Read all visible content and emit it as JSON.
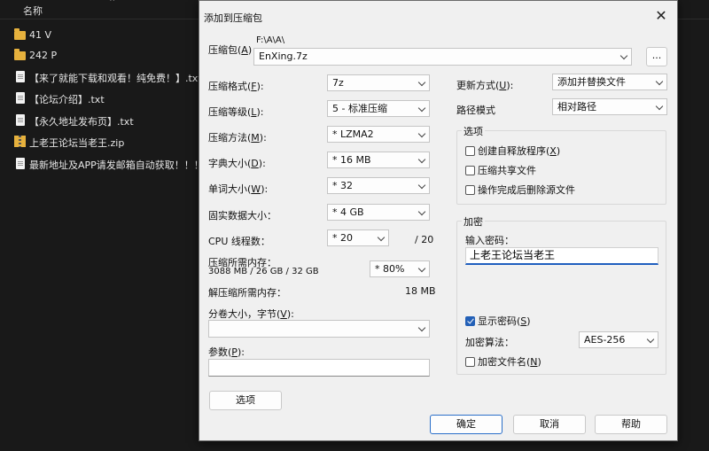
{
  "explorer": {
    "column_name": "名称",
    "items": [
      {
        "name": "41 V",
        "type": "folder"
      },
      {
        "name": "242 P",
        "type": "folder"
      },
      {
        "name": "【来了就能下载和观看！纯免费！】.txt",
        "type": "txt"
      },
      {
        "name": "【论坛介绍】.txt",
        "type": "txt"
      },
      {
        "name": "【永久地址发布页】.txt",
        "type": "txt"
      },
      {
        "name": "上老王论坛当老王.zip",
        "type": "zip"
      },
      {
        "name": "最新地址及APP请发邮箱自动获取！！！.txt",
        "type": "txt"
      }
    ]
  },
  "dialog": {
    "title": "添加到压缩包",
    "close_glyph": "✕",
    "archive": {
      "label": "压缩包(",
      "label_key": "A",
      "label_end": ")",
      "path": "F:\\A\\A\\",
      "filename": "EnXing.7z",
      "browse_label": "..."
    },
    "format": {
      "label": "压缩格式(",
      "key": "F",
      "end": "):",
      "value": "7z"
    },
    "level": {
      "label": "压缩等级(",
      "key": "L",
      "end": "):",
      "value": "5 - 标准压缩"
    },
    "method": {
      "label": "压缩方法(",
      "key": "M",
      "end": "):",
      "value": "* LZMA2"
    },
    "dict": {
      "label": "字典大小(",
      "key": "D",
      "end": "):",
      "value": "* 16 MB"
    },
    "word": {
      "label": "单词大小(",
      "key": "W",
      "end": "):",
      "value": "* 32"
    },
    "solid": {
      "label": "固实数据大小：",
      "value": "* 4 GB"
    },
    "threads": {
      "label": "CPU 线程数：",
      "value": "* 20",
      "max": "/ 20"
    },
    "mem_compress": {
      "label": "压缩所需内存：",
      "detail": "3088 MB / 26 GB / 32 GB",
      "value": "* 80%"
    },
    "mem_decompress": {
      "label": "解压缩所需内存：",
      "value": "18 MB"
    },
    "volume": {
      "label": "分卷大小，字节(",
      "key": "V",
      "end": "):",
      "value": ""
    },
    "params": {
      "label": "参数(",
      "key": "P",
      "end": "):",
      "value": ""
    },
    "options_button": "选项",
    "update_mode": {
      "label": "更新方式(",
      "key": "U",
      "end": "):",
      "value": "添加并替换文件"
    },
    "path_mode": {
      "label": "路径模式",
      "value": "相对路径"
    },
    "options_group": {
      "title": "选项",
      "sfx": {
        "label": "创建自释放程序(",
        "key": "X",
        "end": ")",
        "checked": false
      },
      "shared": {
        "label": "压缩共享文件",
        "checked": false
      },
      "delete_after": {
        "label": "操作完成后删除源文件",
        "checked": false
      }
    },
    "encryption": {
      "title": "加密",
      "password_label": "输入密码：",
      "password_value": "上老王论坛当老王",
      "show_password": {
        "label": "显示密码(",
        "key": "S",
        "end": ")",
        "checked": true
      },
      "method_label": "加密算法：",
      "method_value": "AES-256",
      "encrypt_names": {
        "label": "加密文件名(",
        "key": "N",
        "end": ")",
        "checked": false
      }
    },
    "buttons": {
      "ok": "确定",
      "cancel": "取消",
      "help": "帮助"
    }
  },
  "colors": {
    "accent": "#2360b7",
    "dialog_bg": "#f0f0f0",
    "explorer_bg": "#191919"
  }
}
